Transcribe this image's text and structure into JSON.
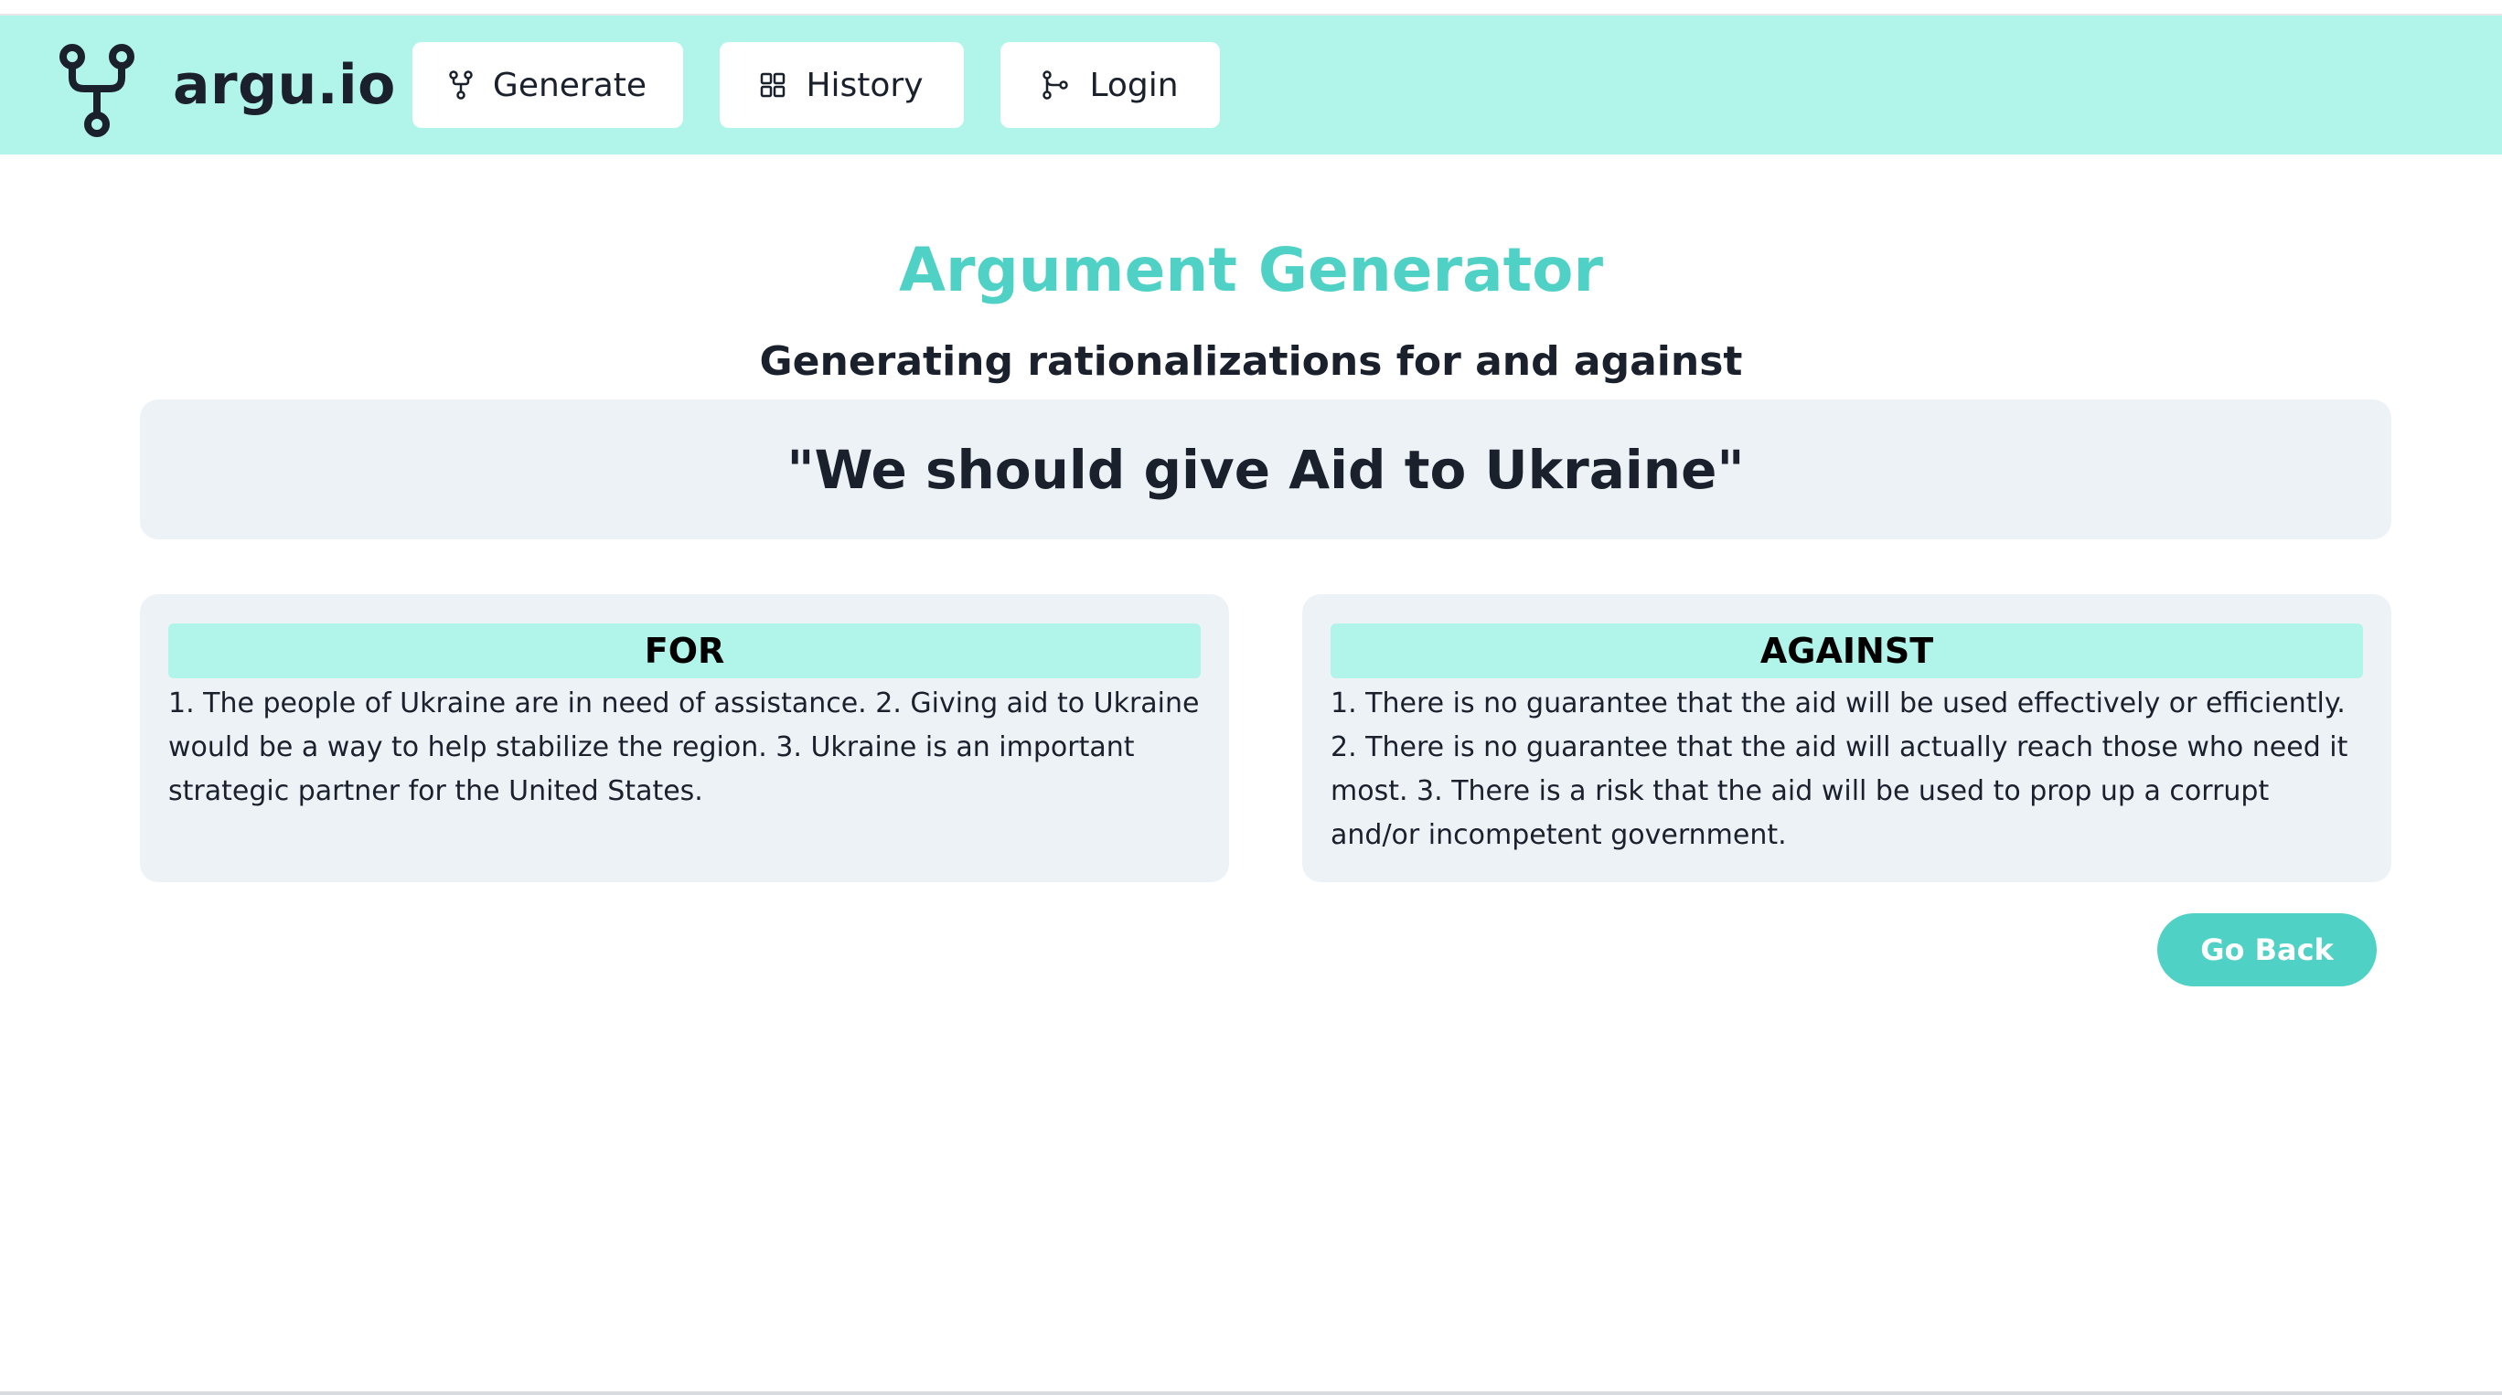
{
  "nav": {
    "brand": "argu.io",
    "logo_icon": "branch-fork-icon",
    "buttons": [
      {
        "label": "Generate",
        "icon": "fork-icon"
      },
      {
        "label": "History",
        "icon": "grid-icon"
      },
      {
        "label": "Login",
        "icon": "git-branch-icon"
      }
    ]
  },
  "main": {
    "title": "Argument Generator",
    "subtitle": "Generating rationalizations for and against",
    "topic": "\"We should give Aid to Ukraine\"",
    "for": {
      "heading": "FOR",
      "text": "1. The people of Ukraine are in need of assistance. 2. Giving aid to Ukraine would be a way to help stabilize the region. 3. Ukraine is an important strategic partner for the United States."
    },
    "against": {
      "heading": "AGAINST",
      "text": "1. There is no guarantee that the aid will be used effectively or efficiently. 2. There is no guarantee that the aid will actually reach those who need it most. 3. There is a risk that the aid will be used to prop up a corrupt and/or incompetent government."
    },
    "go_back_label": "Go Back"
  },
  "colors": {
    "navbar_bg": "#b1f5ea",
    "accent": "#4fd1c5",
    "card_bg": "#edf2f7",
    "text": "#1a202c"
  }
}
